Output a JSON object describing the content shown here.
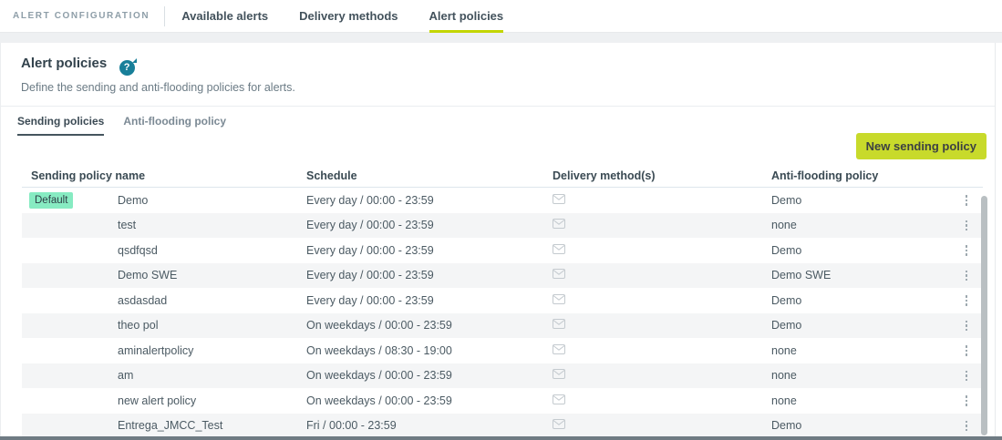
{
  "topbar": {
    "app_title": "ALERT CONFIGURATION",
    "tabs": [
      {
        "label": "Available alerts",
        "active": false
      },
      {
        "label": "Delivery methods",
        "active": false
      },
      {
        "label": "Alert policies",
        "active": true
      }
    ]
  },
  "page": {
    "title": "Alert policies",
    "help_icon": "question-mark-circle-icon",
    "help_glyph": "?",
    "description": "Define the sending and anti-flooding policies for alerts."
  },
  "subtabs": [
    {
      "label": "Sending policies",
      "active": true
    },
    {
      "label": "Anti-flooding policy",
      "active": false
    }
  ],
  "actions": {
    "new_sending_policy": "New sending policy"
  },
  "table": {
    "columns": [
      "Sending policy name",
      "Schedule",
      "Delivery method(s)",
      "Anti-flooding policy"
    ],
    "delivery_icon": "email-envelope-icon",
    "row_menu_icon": "kebab-menu-icon",
    "rows": [
      {
        "badge": "Default",
        "name": "Demo",
        "schedule": "Every day / 00:00 - 23:59",
        "anti_flooding": "Demo"
      },
      {
        "badge": "",
        "name": "test",
        "schedule": "Every day / 00:00 - 23:59",
        "anti_flooding": "none"
      },
      {
        "badge": "",
        "name": "qsdfqsd",
        "schedule": "Every day / 00:00 - 23:59",
        "anti_flooding": "Demo"
      },
      {
        "badge": "",
        "name": "Demo SWE",
        "schedule": "Every day / 00:00 - 23:59",
        "anti_flooding": "Demo SWE"
      },
      {
        "badge": "",
        "name": "asdasdad",
        "schedule": "Every day / 00:00 - 23:59",
        "anti_flooding": "Demo"
      },
      {
        "badge": "",
        "name": "theo pol",
        "schedule": "On weekdays / 00:00 - 23:59",
        "anti_flooding": "Demo"
      },
      {
        "badge": "",
        "name": "aminalertpolicy",
        "schedule": "On weekdays / 08:30 - 19:00",
        "anti_flooding": "none"
      },
      {
        "badge": "",
        "name": "am",
        "schedule": "On weekdays / 00:00 - 23:59",
        "anti_flooding": "none"
      },
      {
        "badge": "",
        "name": "new alert policy",
        "schedule": "On weekdays / 00:00 - 23:59",
        "anti_flooding": "none"
      },
      {
        "badge": "",
        "name": "Entrega_JMCC_Test",
        "schedule": "Fri / 00:00 - 23:59",
        "anti_flooding": "Demo"
      }
    ]
  },
  "colors": {
    "accent_green": "#c3d600",
    "button_green": "#c8da2b",
    "badge_mint": "#87ebc2",
    "help_teal": "#187f99",
    "stripe_gray": "#f4f5f6",
    "bottom_bar": "#6f7b83"
  }
}
